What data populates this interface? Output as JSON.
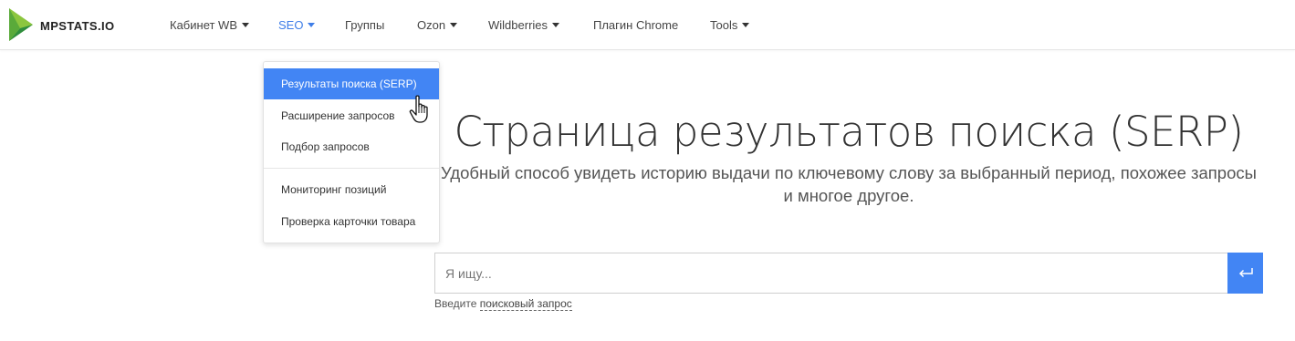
{
  "brand": {
    "name": "MPSTATS.IO",
    "logo_icon": "play-triangle-logo",
    "colors": {
      "light": "#8cc63f",
      "dark": "#2f8d3e"
    }
  },
  "nav": {
    "items": [
      {
        "label": "Кабинет WB",
        "has_dropdown": true,
        "active": false
      },
      {
        "label": "SEO",
        "has_dropdown": true,
        "active": true
      },
      {
        "label": "Группы",
        "has_dropdown": false,
        "active": false
      },
      {
        "label": "Ozon",
        "has_dropdown": true,
        "active": false
      },
      {
        "label": "Wildberries",
        "has_dropdown": true,
        "active": false
      },
      {
        "label": "Плагин Chrome",
        "has_dropdown": false,
        "active": false
      },
      {
        "label": "Tools",
        "has_dropdown": true,
        "active": false
      }
    ]
  },
  "seo_menu": {
    "items": [
      {
        "label": "Результаты поиска (SERP)",
        "highlighted": true
      },
      {
        "label": "Расширение запросов"
      },
      {
        "label": "Подбор запросов"
      },
      {
        "label": "Мониторинг позиций"
      },
      {
        "label": "Проверка карточки товара"
      }
    ]
  },
  "hero": {
    "title": "Страница результатов поиска (SERP)",
    "subtitle": "Удобный способ увидеть историю выдачи по ключевому слову за выбранный период, похожее запросы и многое другое."
  },
  "search": {
    "placeholder": "Я ищу...",
    "value": "",
    "submit_icon": "enter-return-icon",
    "hint_prefix": "Введите",
    "hint_link": "поисковый запрос"
  },
  "colors": {
    "accent": "#4285f4",
    "nav_active": "#3f7ee8"
  }
}
